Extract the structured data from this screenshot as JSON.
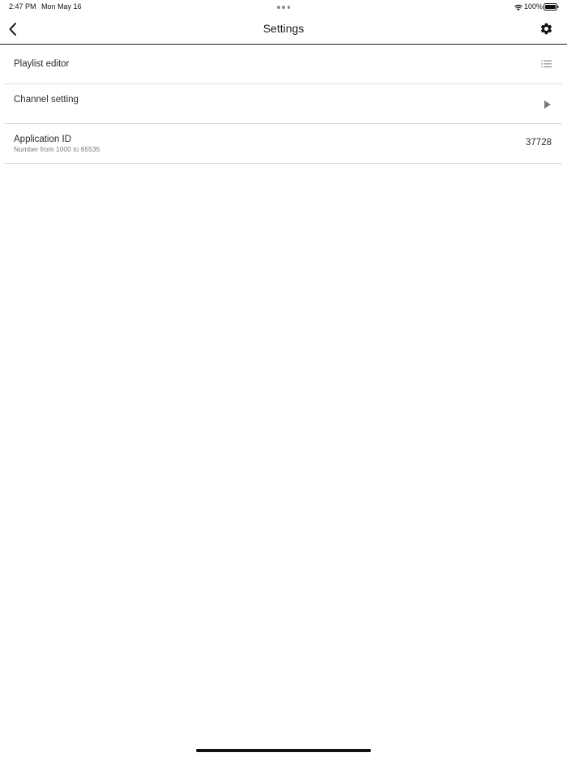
{
  "status_bar": {
    "time": "2:47 PM",
    "date": "Mon May 16",
    "battery": "100%",
    "icons": [
      "wifi-icon",
      "battery-icon",
      "multitask-dots-icon"
    ]
  },
  "nav": {
    "title": "Settings",
    "back_icon": "chevron-left-icon",
    "settings_icon": "gear-icon"
  },
  "settings": {
    "rows": [
      {
        "label": "Playlist editor",
        "icon": "list-icon"
      },
      {
        "label": "Channel setting",
        "icon": "play-triangle-icon"
      },
      {
        "label": "Application ID",
        "sublabel": "Number from 1000 to 65535",
        "value": "37728"
      }
    ]
  },
  "colors": {
    "text": "#1a1a1a",
    "divider": "#dadada",
    "secondary_text": "#7a7a7a",
    "icon_gray": "#8a8a8a"
  }
}
